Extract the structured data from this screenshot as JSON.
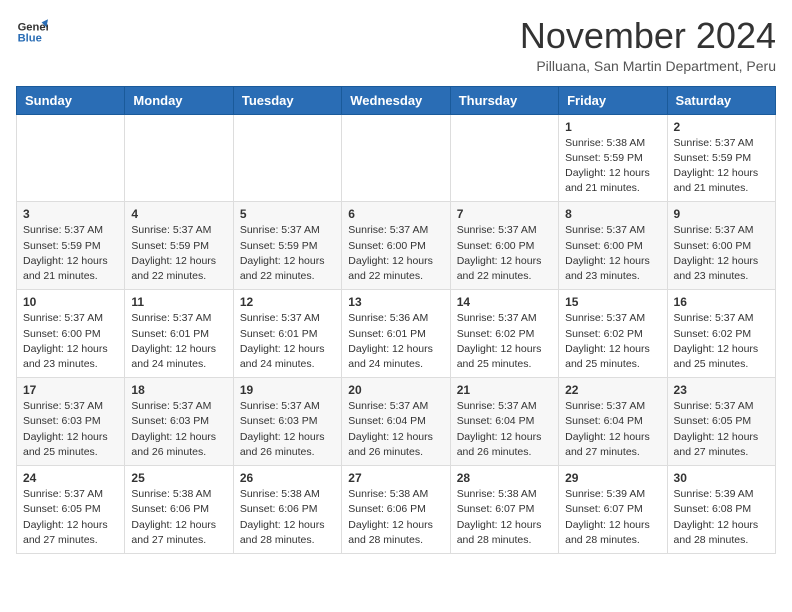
{
  "header": {
    "logo_line1": "General",
    "logo_line2": "Blue",
    "month_title": "November 2024",
    "subtitle": "Pilluana, San Martin Department, Peru"
  },
  "weekdays": [
    "Sunday",
    "Monday",
    "Tuesday",
    "Wednesday",
    "Thursday",
    "Friday",
    "Saturday"
  ],
  "weeks": [
    [
      {
        "day": "",
        "info": ""
      },
      {
        "day": "",
        "info": ""
      },
      {
        "day": "",
        "info": ""
      },
      {
        "day": "",
        "info": ""
      },
      {
        "day": "",
        "info": ""
      },
      {
        "day": "1",
        "info": "Sunrise: 5:38 AM\nSunset: 5:59 PM\nDaylight: 12 hours\nand 21 minutes."
      },
      {
        "day": "2",
        "info": "Sunrise: 5:37 AM\nSunset: 5:59 PM\nDaylight: 12 hours\nand 21 minutes."
      }
    ],
    [
      {
        "day": "3",
        "info": "Sunrise: 5:37 AM\nSunset: 5:59 PM\nDaylight: 12 hours\nand 21 minutes."
      },
      {
        "day": "4",
        "info": "Sunrise: 5:37 AM\nSunset: 5:59 PM\nDaylight: 12 hours\nand 22 minutes."
      },
      {
        "day": "5",
        "info": "Sunrise: 5:37 AM\nSunset: 5:59 PM\nDaylight: 12 hours\nand 22 minutes."
      },
      {
        "day": "6",
        "info": "Sunrise: 5:37 AM\nSunset: 6:00 PM\nDaylight: 12 hours\nand 22 minutes."
      },
      {
        "day": "7",
        "info": "Sunrise: 5:37 AM\nSunset: 6:00 PM\nDaylight: 12 hours\nand 22 minutes."
      },
      {
        "day": "8",
        "info": "Sunrise: 5:37 AM\nSunset: 6:00 PM\nDaylight: 12 hours\nand 23 minutes."
      },
      {
        "day": "9",
        "info": "Sunrise: 5:37 AM\nSunset: 6:00 PM\nDaylight: 12 hours\nand 23 minutes."
      }
    ],
    [
      {
        "day": "10",
        "info": "Sunrise: 5:37 AM\nSunset: 6:00 PM\nDaylight: 12 hours\nand 23 minutes."
      },
      {
        "day": "11",
        "info": "Sunrise: 5:37 AM\nSunset: 6:01 PM\nDaylight: 12 hours\nand 24 minutes."
      },
      {
        "day": "12",
        "info": "Sunrise: 5:37 AM\nSunset: 6:01 PM\nDaylight: 12 hours\nand 24 minutes."
      },
      {
        "day": "13",
        "info": "Sunrise: 5:36 AM\nSunset: 6:01 PM\nDaylight: 12 hours\nand 24 minutes."
      },
      {
        "day": "14",
        "info": "Sunrise: 5:37 AM\nSunset: 6:02 PM\nDaylight: 12 hours\nand 25 minutes."
      },
      {
        "day": "15",
        "info": "Sunrise: 5:37 AM\nSunset: 6:02 PM\nDaylight: 12 hours\nand 25 minutes."
      },
      {
        "day": "16",
        "info": "Sunrise: 5:37 AM\nSunset: 6:02 PM\nDaylight: 12 hours\nand 25 minutes."
      }
    ],
    [
      {
        "day": "17",
        "info": "Sunrise: 5:37 AM\nSunset: 6:03 PM\nDaylight: 12 hours\nand 25 minutes."
      },
      {
        "day": "18",
        "info": "Sunrise: 5:37 AM\nSunset: 6:03 PM\nDaylight: 12 hours\nand 26 minutes."
      },
      {
        "day": "19",
        "info": "Sunrise: 5:37 AM\nSunset: 6:03 PM\nDaylight: 12 hours\nand 26 minutes."
      },
      {
        "day": "20",
        "info": "Sunrise: 5:37 AM\nSunset: 6:04 PM\nDaylight: 12 hours\nand 26 minutes."
      },
      {
        "day": "21",
        "info": "Sunrise: 5:37 AM\nSunset: 6:04 PM\nDaylight: 12 hours\nand 26 minutes."
      },
      {
        "day": "22",
        "info": "Sunrise: 5:37 AM\nSunset: 6:04 PM\nDaylight: 12 hours\nand 27 minutes."
      },
      {
        "day": "23",
        "info": "Sunrise: 5:37 AM\nSunset: 6:05 PM\nDaylight: 12 hours\nand 27 minutes."
      }
    ],
    [
      {
        "day": "24",
        "info": "Sunrise: 5:37 AM\nSunset: 6:05 PM\nDaylight: 12 hours\nand 27 minutes."
      },
      {
        "day": "25",
        "info": "Sunrise: 5:38 AM\nSunset: 6:06 PM\nDaylight: 12 hours\nand 27 minutes."
      },
      {
        "day": "26",
        "info": "Sunrise: 5:38 AM\nSunset: 6:06 PM\nDaylight: 12 hours\nand 28 minutes."
      },
      {
        "day": "27",
        "info": "Sunrise: 5:38 AM\nSunset: 6:06 PM\nDaylight: 12 hours\nand 28 minutes."
      },
      {
        "day": "28",
        "info": "Sunrise: 5:38 AM\nSunset: 6:07 PM\nDaylight: 12 hours\nand 28 minutes."
      },
      {
        "day": "29",
        "info": "Sunrise: 5:39 AM\nSunset: 6:07 PM\nDaylight: 12 hours\nand 28 minutes."
      },
      {
        "day": "30",
        "info": "Sunrise: 5:39 AM\nSunset: 6:08 PM\nDaylight: 12 hours\nand 28 minutes."
      }
    ]
  ]
}
